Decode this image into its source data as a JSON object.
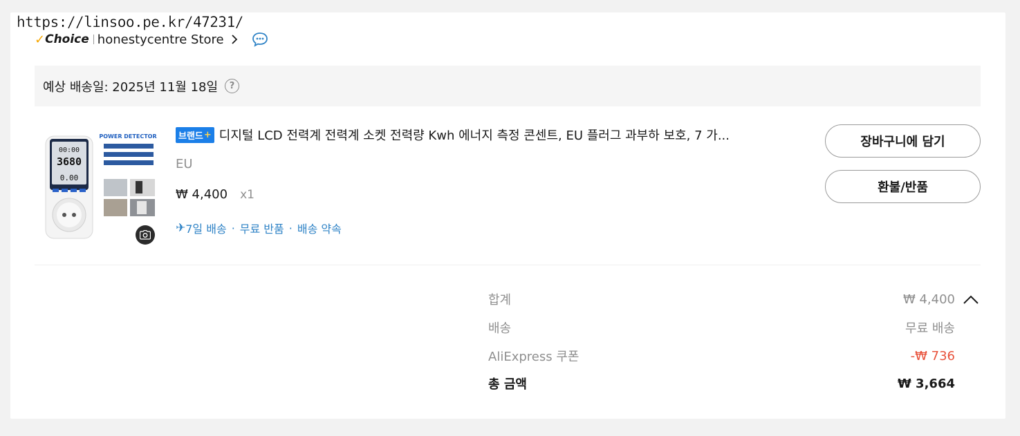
{
  "watermark": "https://linsoo.pe.kr/47231/",
  "store": {
    "choice_label": "Choice",
    "name": "honestycentre Store",
    "chevron_icon": "chevron-right-icon",
    "chat_icon": "chat-bubble-icon"
  },
  "delivery": {
    "text": "예상 배송일: 2025년 11월 18일",
    "help_glyph": "?"
  },
  "product": {
    "image": {
      "header": "POWER DETECTOR",
      "display_top": "00:00",
      "display_mid": "3680",
      "display_bottom": "0.00"
    },
    "brand_badge": "브랜드",
    "brand_plus": "+",
    "title": "디지털 LCD 전력계 전력계 소켓 전력량 Kwh 에너지 측정 콘센트, EU 플러그 과부하 보호, 7 가...",
    "variant": "EU",
    "price": "₩ 4,400",
    "quantity": "x1",
    "shipping": {
      "fast": "7일 배송",
      "returns": "무료 반품",
      "promise": "배송 약속"
    }
  },
  "buttons": {
    "cart": "장바구니에 담기",
    "refund": "환불/반품"
  },
  "summary": {
    "subtotal_label": "합계",
    "subtotal_value": "₩ 4,400",
    "shipping_label": "배송",
    "shipping_value": "무료 배송",
    "coupon_label": "AliExpress 쿠폰",
    "coupon_value": "-₩ 736",
    "total_label": "총 금액",
    "total_value": "₩ 3,664"
  },
  "colors": {
    "accent_blue": "#1b7fe8",
    "link_blue": "#2f83c6",
    "discount_red": "#e8513a",
    "choice_check": "#f7a700"
  }
}
